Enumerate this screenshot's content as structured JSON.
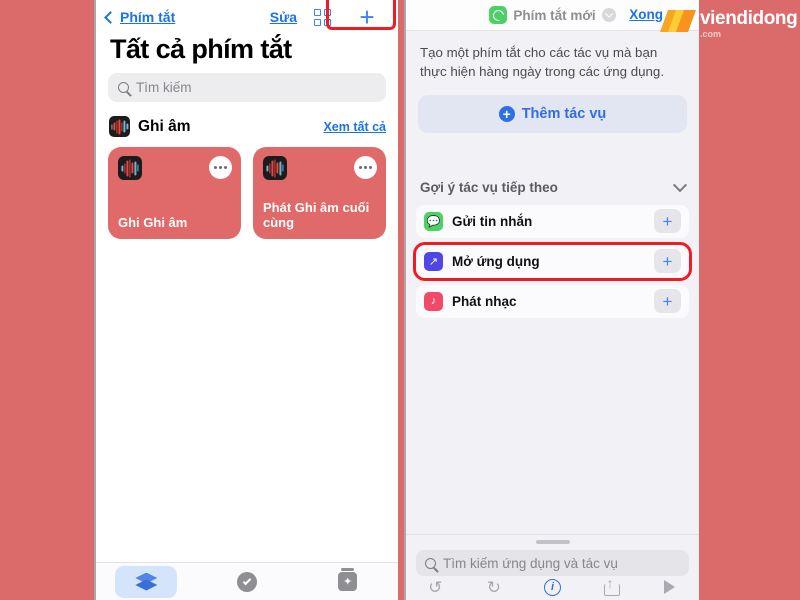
{
  "theme": {
    "page_bg": "#db6a6a",
    "ios_blue": "#1a73e8",
    "accent_blue": "#2f6fe4",
    "highlight_red": "#ee1c25",
    "card_red": "#e06a6a"
  },
  "left_phone": {
    "nav": {
      "back_label": "Phím tắt",
      "back_icon": "chevron-left-icon",
      "edit_label": "Sửa",
      "grid_icon": "grid-view-icon",
      "add_icon": "plus-icon"
    },
    "page_title": "Tất cả phím tắt",
    "search": {
      "placeholder": "Tìm kiếm",
      "icon": "search-icon",
      "value": ""
    },
    "section": {
      "icon": "voice-memos-icon",
      "title": "Ghi âm",
      "see_all_label": "Xem tất cả"
    },
    "shortcut_cards": [
      {
        "label": "Ghi Ghi âm",
        "icon": "voice-memos-icon",
        "menu_icon": "ellipsis-icon"
      },
      {
        "label": "Phát Ghi âm cuối cùng",
        "icon": "voice-memos-icon",
        "menu_icon": "ellipsis-icon"
      }
    ],
    "tab_bar": [
      {
        "name": "shortcuts",
        "icon": "layers-icon",
        "selected": true
      },
      {
        "name": "automation",
        "icon": "check-circle-icon",
        "selected": false
      },
      {
        "name": "gallery",
        "icon": "gallery-jar-icon",
        "selected": false
      }
    ]
  },
  "right_phone": {
    "nav": {
      "shortcut_icon": "shortcuts-app-icon",
      "title": "Phím tắt mới",
      "dropdown_icon": "chevron-down-circle-icon",
      "done_label": "Xong"
    },
    "description": "Tạo một phím tắt cho các tác vụ mà bạn thực hiện hàng ngày trong các ứng dụng.",
    "add_action": {
      "label": "Thêm tác vụ",
      "icon": "plus-circle-icon"
    },
    "suggestions_header": {
      "label": "Gợi ý tác vụ tiếp theo",
      "icon": "chevron-down-icon"
    },
    "suggestions": [
      {
        "label": "Gửi tin nhắn",
        "icon": "messages-icon",
        "icon_color": "#4cd167",
        "glyph": "●",
        "add_icon": "plus-icon",
        "highlighted": false
      },
      {
        "label": "Mở ứng dụng",
        "icon": "open-app-icon",
        "icon_color": "#4f46e5",
        "glyph": "↗",
        "add_icon": "plus-icon",
        "highlighted": true
      },
      {
        "label": "Phát nhạc",
        "icon": "music-icon",
        "icon_color": "#f2486a",
        "glyph": "♪",
        "add_icon": "plus-icon",
        "highlighted": false
      }
    ],
    "bottom_search": {
      "placeholder": "Tìm kiếm ứng dụng và tác vụ",
      "icon": "search-icon",
      "value": ""
    },
    "toolbar": [
      {
        "name": "undo",
        "icon": "undo-icon",
        "glyph": "↺",
        "active": false
      },
      {
        "name": "redo",
        "icon": "redo-icon",
        "glyph": "↻",
        "active": false
      },
      {
        "name": "info",
        "icon": "info-circle-icon",
        "glyph": "i",
        "active": true
      },
      {
        "name": "share",
        "icon": "share-icon",
        "glyph": "",
        "active": false
      },
      {
        "name": "run",
        "icon": "play-icon",
        "glyph": "",
        "active": false
      }
    ]
  },
  "watermark": {
    "main": "viendidong",
    "sub": ".com",
    "logo_icon": "ribbon-logo-icon"
  }
}
